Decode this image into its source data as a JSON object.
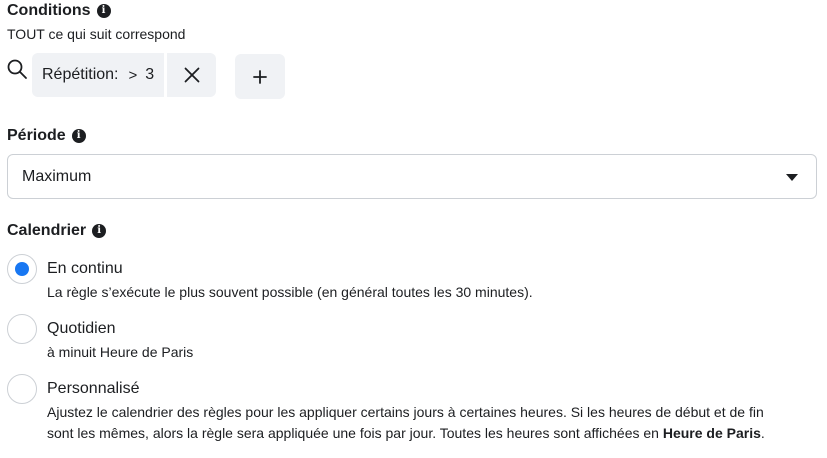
{
  "conditions": {
    "title": "Conditions",
    "subtitle": "TOUT ce qui suit correspond",
    "chip": {
      "field": "Répétition:",
      "operator": ">",
      "value": "3"
    },
    "add_label": "+"
  },
  "period": {
    "title": "Période",
    "selected": "Maximum"
  },
  "schedule": {
    "title": "Calendrier",
    "options": [
      {
        "label": "En continu",
        "description": "La règle s’exécute le plus souvent possible (en général toutes les 30 minutes).",
        "checked": true
      },
      {
        "label": "Quotidien",
        "description": "à minuit Heure de Paris",
        "checked": false
      },
      {
        "label": "Personnalisé",
        "description_line1": "Ajustez le calendrier des règles pour les appliquer certains jours à certaines heures. Si les heures de début et de fin",
        "description_line2": "sont les mêmes, alors la règle sera appliquée une fois par jour. Toutes les heures sont affichées en",
        "description_bold": "Heure de Paris",
        "description_end": ".",
        "checked": false
      }
    ]
  },
  "colors": {
    "accent": "#1877f2",
    "text": "#1c1e21",
    "chip_bg": "#f0f2f5",
    "border": "#ccd0d5"
  },
  "icons": {
    "search": "search-icon",
    "close": "close-icon",
    "info": "info-icon",
    "caret": "caret-down-icon"
  }
}
